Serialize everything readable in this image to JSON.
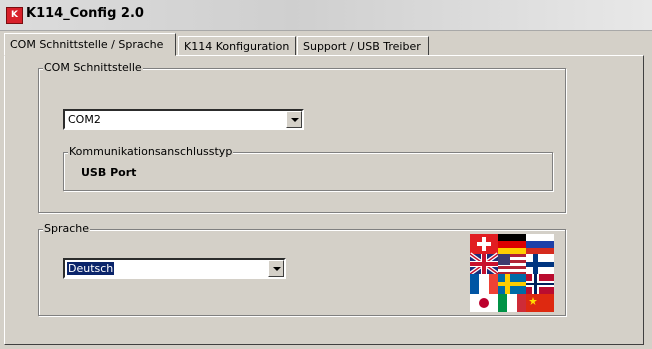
{
  "window": {
    "title": "K114_Config 2.0",
    "icon": "k114-app-icon",
    "icon_letters": "K"
  },
  "tabs": [
    {
      "label": "COM Schnittstelle / Sprache",
      "active": true
    },
    {
      "label": "K114 Konfiguration",
      "active": false
    },
    {
      "label": "Support / USB Treiber",
      "active": false
    }
  ],
  "com_group": {
    "label": "COM Schnittstelle",
    "port_value": "COM2",
    "comm_type_group": {
      "label": "Kommunikationsanschlusstyp",
      "value": "USB Port"
    }
  },
  "language_group": {
    "label": "Sprache",
    "selected": "Deutsch",
    "flags_icon": "language-flags-icon"
  },
  "colors": {
    "background": "#d4d0c8",
    "selection": "#0a246a"
  }
}
